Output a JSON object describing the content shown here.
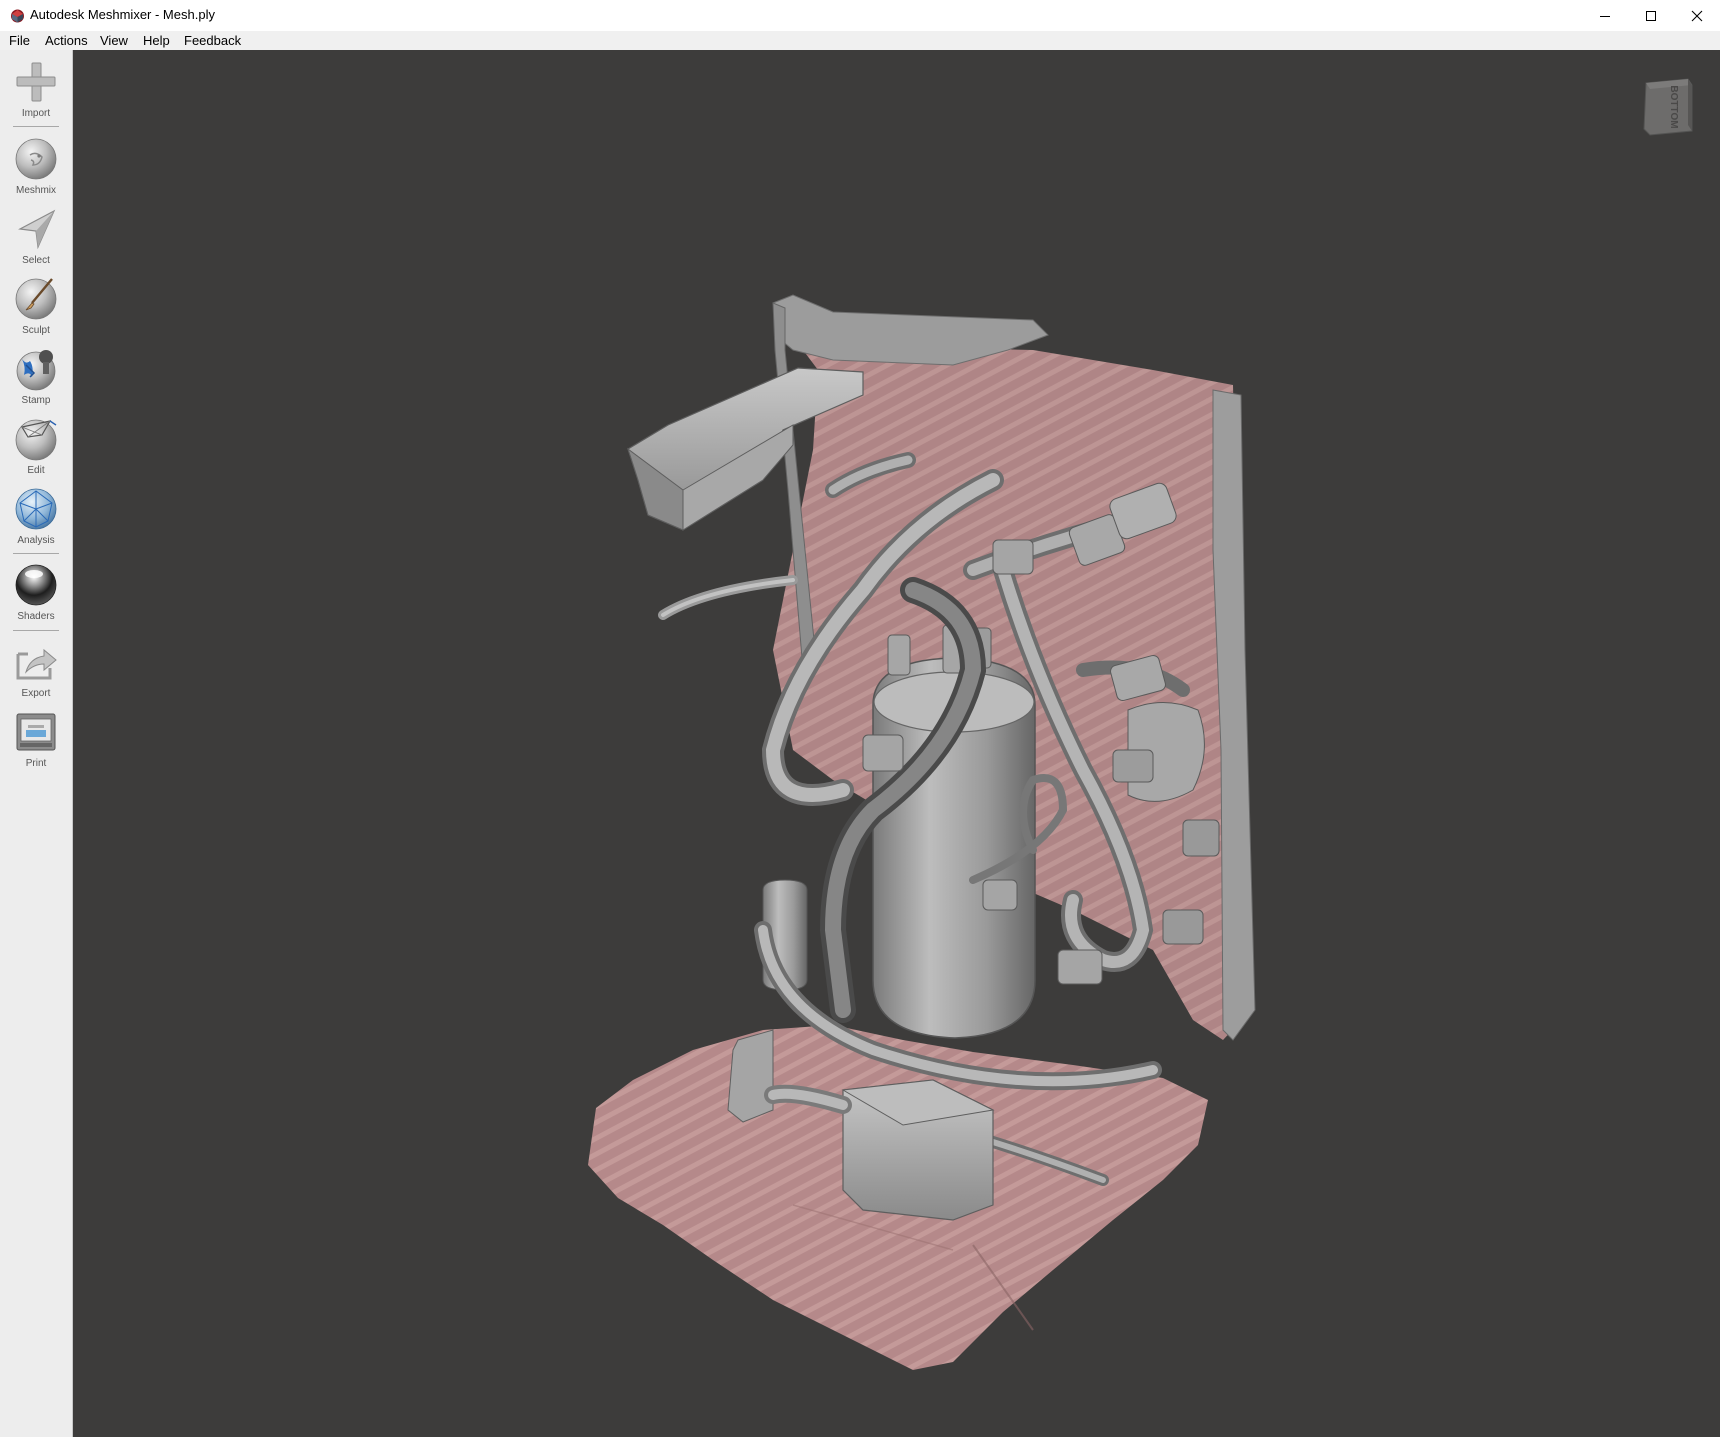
{
  "window": {
    "title": "Autodesk Meshmixer - Mesh.ply",
    "controls": [
      "minimize",
      "maximize",
      "close"
    ]
  },
  "menu": {
    "items": [
      "File",
      "Actions",
      "View",
      "Help",
      "Feedback"
    ]
  },
  "toolbar": {
    "tools": [
      {
        "id": "import",
        "label": "Import",
        "icon": "plus-icon"
      },
      {
        "id": "meshmix",
        "label": "Meshmix",
        "icon": "meshmix-sphere-icon"
      },
      {
        "id": "select",
        "label": "Select",
        "icon": "arrow-pointer-icon"
      },
      {
        "id": "sculpt",
        "label": "Sculpt",
        "icon": "brush-sphere-icon"
      },
      {
        "id": "stamp",
        "label": "Stamp",
        "icon": "stamp-sphere-icon"
      },
      {
        "id": "edit",
        "label": "Edit",
        "icon": "edit-sphere-icon"
      },
      {
        "id": "analysis",
        "label": "Analysis",
        "icon": "analysis-sphere-icon"
      },
      {
        "id": "shaders",
        "label": "Shaders",
        "icon": "shader-sphere-icon"
      },
      {
        "id": "export",
        "label": "Export",
        "icon": "export-icon"
      },
      {
        "id": "print",
        "label": "Print",
        "icon": "printer-icon"
      }
    ]
  },
  "viewport": {
    "view_cube_label": "BOTTOM",
    "background": "#3d3c3b",
    "mesh_color": "#a4a4a4",
    "pink_surface_color": "#b68b89"
  }
}
